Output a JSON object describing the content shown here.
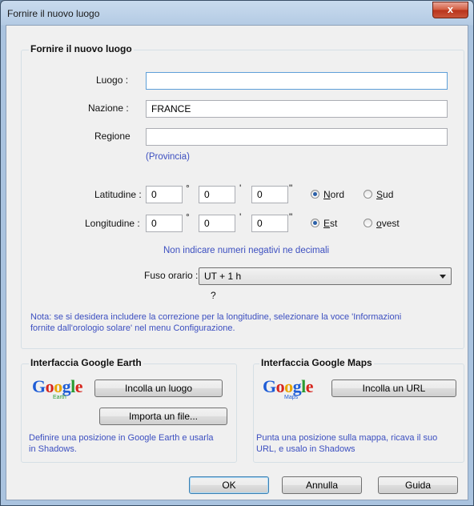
{
  "window": {
    "title": "Fornire il nuovo luogo",
    "close_glyph": "x"
  },
  "main_group": {
    "legend": "Fornire il nuovo luogo",
    "luogo_label": "Luogo :",
    "luogo_value": "",
    "nazione_label": "Nazione :",
    "nazione_value": "FRANCE",
    "regione_label": "Regione",
    "regione_value": "",
    "provincia_hint": "(Provincia)",
    "latitude": {
      "label": "Latitudine :",
      "deg": "0",
      "min": "0",
      "sec": "0",
      "deg_sym": "°",
      "min_sym": "'",
      "sec_sym": "\"",
      "opt1": "Nord",
      "opt2": "Sud",
      "selected": "Nord"
    },
    "longitude": {
      "label": "Longitudine :",
      "deg": "0",
      "min": "0",
      "sec": "0",
      "deg_sym": "°",
      "min_sym": "'",
      "sec_sym": "\"",
      "opt1": "Est",
      "opt2": "ovest",
      "selected": "Est"
    },
    "no_negative_hint": "Non indicare numeri negativi ne decimali",
    "fuso_label": "Fuso orario :",
    "fuso_value": "UT + 1 h",
    "question_mark": "?",
    "note_line1": "Nota: se si desidera includere la correzione per la longitudine, selezionare la voce 'Informazioni",
    "note_line2": "fornite dall'orologio solare' nel menu Configurazione."
  },
  "earth_group": {
    "legend": "Interfaccia Google Earth",
    "logo_sub": "Earth",
    "paste_button": "Incolla un luogo",
    "import_button": "Importa un file...",
    "desc_line1": "Definire una posizione in Google Earth e usarla",
    "desc_line2": "in Shadows."
  },
  "maps_group": {
    "legend": "Interfaccia Google Maps",
    "logo_sub": "Maps",
    "paste_button": "Incolla un URL",
    "desc_line1": "Punta una posizione sulla mappa, ricava il suo",
    "desc_line2": "URL, e usalo in Shadows"
  },
  "google_logo": [
    "G",
    "o",
    "o",
    "g",
    "l",
    "e"
  ],
  "footer": {
    "ok": "OK",
    "annulla": "Annulla",
    "guida": "Guida"
  },
  "colors": {
    "hint_blue": "#3c4fc0",
    "titlebar": "#b4cbe4",
    "close_red": "#c9543a"
  }
}
